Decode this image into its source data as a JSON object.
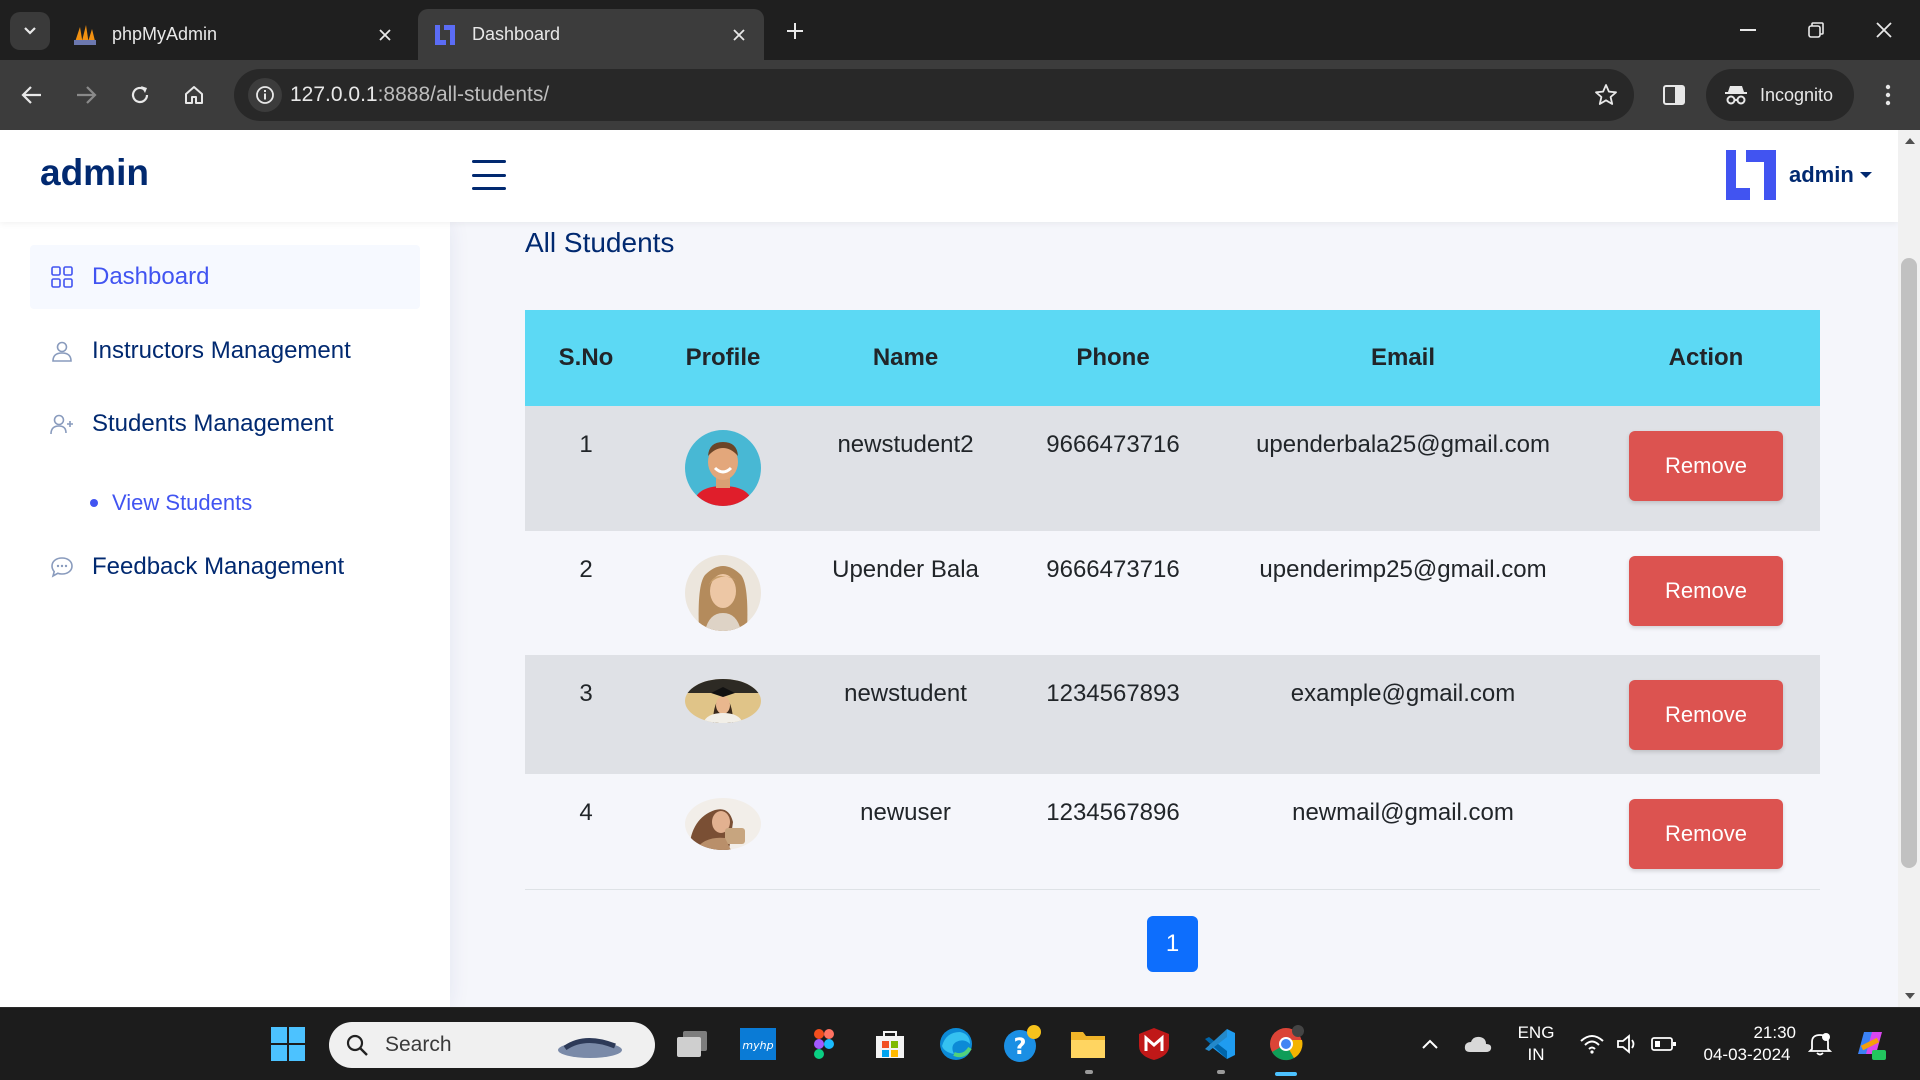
{
  "browser": {
    "tabs": [
      {
        "title": "phpMyAdmin",
        "active": false
      },
      {
        "title": "Dashboard",
        "active": true
      }
    ],
    "url_host": "127.0.0.1",
    "url_path": ":8888/all-students/",
    "incognito_label": "Incognito"
  },
  "app": {
    "brand": "admin",
    "user_name": "admin"
  },
  "sidebar": {
    "items": [
      {
        "label": "Dashboard",
        "icon": "grid-icon",
        "active": true
      },
      {
        "label": "Instructors Management",
        "icon": "person-icon"
      },
      {
        "label": "Students Management",
        "icon": "person-add-icon"
      },
      {
        "label": "Feedback Management",
        "icon": "chat-icon"
      }
    ],
    "sub_items": [
      {
        "label": "View Students"
      }
    ]
  },
  "page": {
    "title": "All Students"
  },
  "table": {
    "headers": [
      "S.No",
      "Profile",
      "Name",
      "Phone",
      "Email",
      "Action"
    ],
    "rows": [
      {
        "sno": "1",
        "name": "newstudent2",
        "phone": "9666473716",
        "email": "upenderbala25@gmail.com",
        "action": "Remove"
      },
      {
        "sno": "2",
        "name": "Upender Bala",
        "phone": "9666473716",
        "email": "upenderimp25@gmail.com",
        "action": "Remove"
      },
      {
        "sno": "3",
        "name": "newstudent",
        "phone": "1234567893",
        "email": "example@gmail.com",
        "action": "Remove"
      },
      {
        "sno": "4",
        "name": "newuser",
        "phone": "1234567896",
        "email": "newmail@gmail.com",
        "action": "Remove"
      }
    ]
  },
  "pagination": {
    "current_page": "1"
  },
  "taskbar": {
    "search_placeholder": "Search",
    "lang_line1": "ENG",
    "lang_line2": "IN",
    "time": "21:30",
    "date": "04-03-2024"
  },
  "colors": {
    "table_header": "#5cd9f4",
    "remove_button": "#dc5350",
    "brand_text": "#012970",
    "pagination_active": "#0d6efd"
  }
}
